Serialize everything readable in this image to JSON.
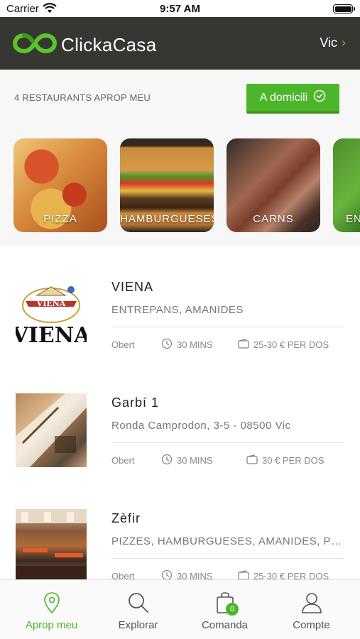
{
  "status_bar": {
    "carrier": "Carrier",
    "time": "9:57 AM"
  },
  "header": {
    "brand": "ClickaCasa",
    "city": "Vic",
    "logo_icon": "infinity-logo-icon",
    "city_chevron": "›"
  },
  "filter": {
    "count_label": "4 RESTAURANTS APROP MEU",
    "delivery_label": "A domicili",
    "delivery_icon": "check-circle-icon"
  },
  "categories": [
    {
      "label": "PIZZA"
    },
    {
      "label": "HAMBURGUESES"
    },
    {
      "label": "CARNS"
    },
    {
      "label": "EN AM"
    }
  ],
  "restaurants": [
    {
      "name": "VIENA",
      "subtitle": "ENTREPANS, AMANIDES",
      "logo_text": "VIENA",
      "status": "Obert",
      "time": "30 MINS",
      "price": "25-30 € PER DOS"
    },
    {
      "name": "Garbí 1",
      "subtitle": "Ronda Camprodon, 3-5 - 08500 Vic",
      "status": "Obert",
      "time": "30 MINS",
      "price": "30 € PER DOS"
    },
    {
      "name": "Zèfir",
      "subtitle": "PIZZES, HAMBURGUESES, AMANIDES, PLA...",
      "status": "Obert",
      "time": "30 MINS",
      "price": "25-30 € PER DOS"
    }
  ],
  "tabbar": {
    "tabs": [
      {
        "label": "Aprop meu",
        "icon": "location-pin-icon",
        "active": true
      },
      {
        "label": "Explorar",
        "icon": "search-icon",
        "active": false
      },
      {
        "label": "Comanda",
        "icon": "shopping-bag-icon",
        "active": false
      },
      {
        "label": "Compte",
        "icon": "user-icon",
        "active": false
      }
    ],
    "cart_count": "0"
  },
  "colors": {
    "header_bg": "#373633",
    "accent_green": "#4db52a",
    "filter_bg": "#f7f7f7"
  }
}
